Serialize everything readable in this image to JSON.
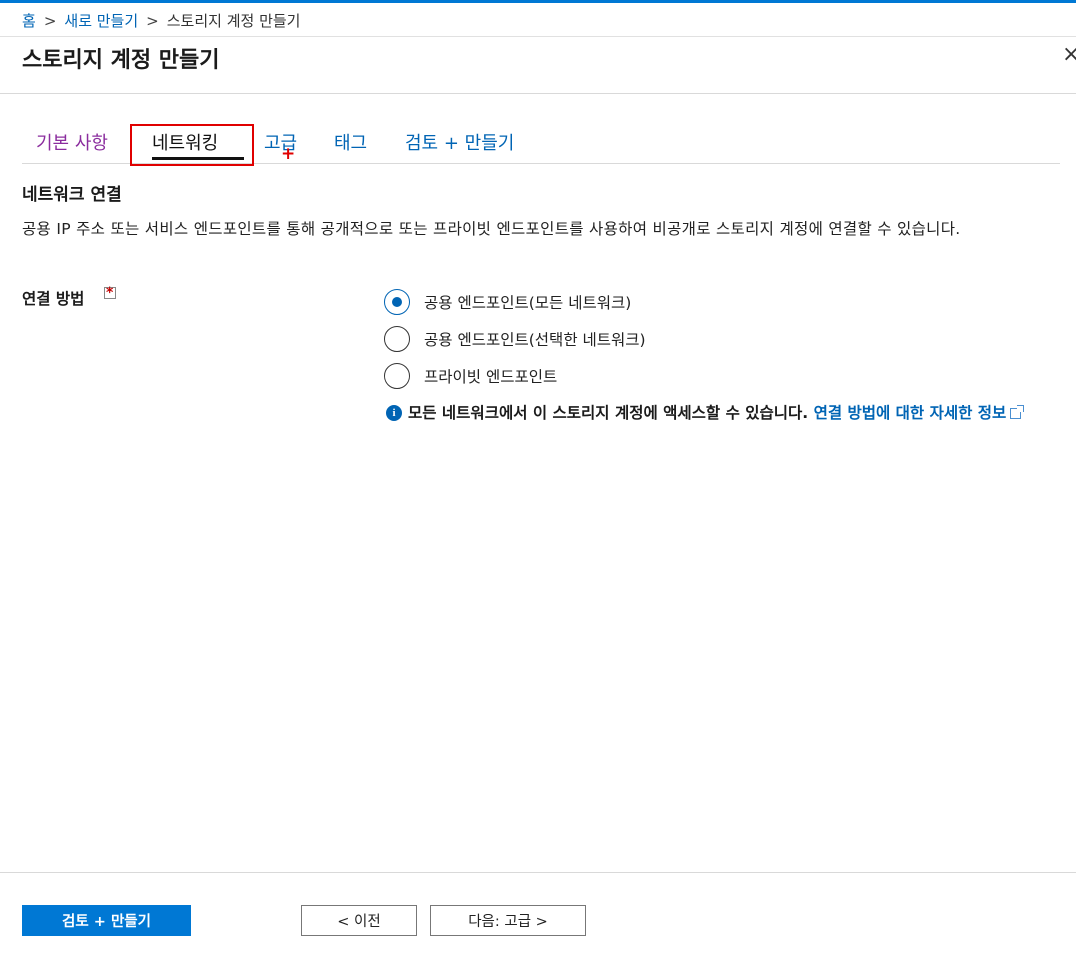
{
  "breadcrumb": {
    "home": "홈",
    "new": "새로 만들기",
    "current": "스토리지 계정 만들기",
    "separator": ">"
  },
  "page": {
    "title": "스토리지 계정 만들기",
    "close_icon": "close-icon",
    "close_glyph": "×"
  },
  "tabs": [
    {
      "label": "기본 사항",
      "state": "visited"
    },
    {
      "label": "네트워킹",
      "state": "active"
    },
    {
      "label": "고급",
      "state": "link"
    },
    {
      "label": "태그",
      "state": "link"
    },
    {
      "label": "검토 + 만들기",
      "state": "link"
    }
  ],
  "cursor_glyph": "+",
  "section": {
    "title": "네트워크 연결",
    "description": "공용 IP 주소 또는 서비스 엔드포인트를 통해 공개적으로 또는 프라이빗 엔드포인트를 사용하여 비공개로 스토리지 계정에 연결할 수 있습니다."
  },
  "connectivity": {
    "label": "연결 방법",
    "required_mark": "*",
    "options": [
      {
        "label": "공용 엔드포인트(모든 네트워크)",
        "selected": true
      },
      {
        "label": "공용 엔드포인트(선택한 네트워크)",
        "selected": false
      },
      {
        "label": "프라이빗 엔드포인트",
        "selected": false
      }
    ],
    "info_icon_glyph": "i",
    "info_text": "모든 네트워크에서 이 스토리지 계정에 액세스할 수 있습니다. ",
    "info_link": "연결 방법에 대한 자세한 정보"
  },
  "footer": {
    "review_create": "검토 + 만들기",
    "previous": "< 이전",
    "next": "다음: 고급 >"
  },
  "colors": {
    "accent": "#0078d4",
    "link": "#0064b4",
    "visited": "#8b2d9e",
    "highlight": "#e00000"
  }
}
